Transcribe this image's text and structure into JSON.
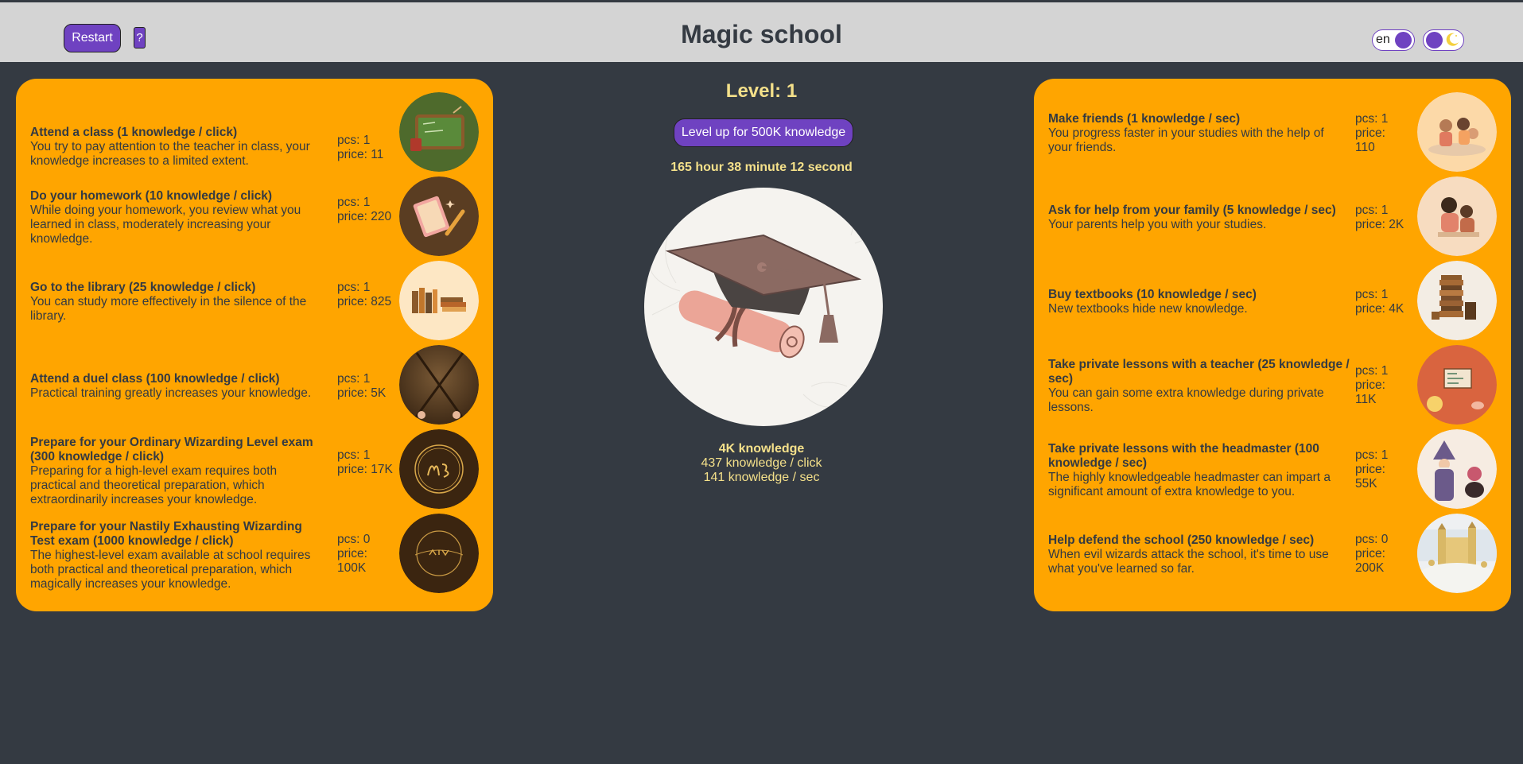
{
  "header": {
    "title": "Magic school",
    "restart_label": "Restart",
    "help_label": "?",
    "language": "en"
  },
  "colors": {
    "accent": "#6f42c1",
    "panel": "#ffa500",
    "background": "#343a42",
    "header_bg": "#d4d4d4",
    "highlight_text": "#f4e08a"
  },
  "center": {
    "level_label": "Level: 1",
    "level_up_label": "Level up for 500K knowledge",
    "timer": "165 hour 38 minute 12 second",
    "knowledge": "4K knowledge",
    "per_click": "437 knowledge / click",
    "per_sec": "141 knowledge / sec",
    "image_icon": "graduation-cap-diploma"
  },
  "click_upgrades": [
    {
      "name": "Attend a class (1 knowledge / click)",
      "desc": "You try to pay attention to the teacher in class, your knowledge increases to a limited extent.",
      "pcs": "pcs: 1",
      "price": "price: 11",
      "icon": "chalkboard-icon"
    },
    {
      "name": "Do your homework (10 knowledge / click)",
      "desc": "While doing your homework, you review what you learned in class, moderately increasing your knowledge.",
      "pcs": "pcs: 1",
      "price": "price: 220",
      "icon": "notebook-pencil-icon"
    },
    {
      "name": "Go to the library (25 knowledge / click)",
      "desc": "You can study more effectively in the silence of the library.",
      "pcs": "pcs: 1",
      "price": "price: 825",
      "icon": "books-icon"
    },
    {
      "name": "Attend a duel class (100 knowledge / click)",
      "desc": "Practical training greatly increases your knowledge.",
      "pcs": "pcs: 1",
      "price": "price: 5K",
      "icon": "wands-icon"
    },
    {
      "name": "Prepare for your Ordinary Wizarding Level exam (300 knowledge / click)",
      "desc": "Preparing for a high-level exam requires both practical and theoretical preparation, which extraordinarily increases your knowledge.",
      "pcs": "pcs: 1",
      "price": "price: 17K",
      "icon": "owl-seal-icon"
    },
    {
      "name": "Prepare for your Nastily Exhausting Wizarding Test exam (1000 knowledge / click)",
      "desc": "The highest-level exam available at school requires both practical and theoretical preparation, which magically increases your knowledge.",
      "pcs": "pcs: 0",
      "price": "price: 100K",
      "icon": "newt-seal-icon"
    }
  ],
  "passive_upgrades": [
    {
      "name": "Make friends (1 knowledge / sec)",
      "desc": "You progress faster in your studies with the help of your friends.",
      "pcs": "pcs: 1",
      "price": "price: 110",
      "icon": "friends-icon"
    },
    {
      "name": "Ask for help from your family (5 knowledge / sec)",
      "desc": "Your parents help you with your studies.",
      "pcs": "pcs: 1",
      "price": "price: 2K",
      "icon": "family-icon"
    },
    {
      "name": "Buy textbooks (10 knowledge / sec)",
      "desc": "New textbooks hide new knowledge.",
      "pcs": "pcs: 1",
      "price": "price: 4K",
      "icon": "textbooks-icon"
    },
    {
      "name": "Take private lessons with a teacher (25 knowledge / sec)",
      "desc": "You can gain some extra knowledge during private lessons.",
      "pcs": "pcs: 1",
      "price": "price: 11K",
      "icon": "teacher-icon"
    },
    {
      "name": "Take private lessons with the headmaster (100 knowledge / sec)",
      "desc": "The highly knowledgeable headmaster can impart a significant amount of extra knowledge to you.",
      "pcs": "pcs: 1",
      "price": "price: 55K",
      "icon": "headmaster-icon"
    },
    {
      "name": "Help defend the school (250 knowledge / sec)",
      "desc": "When evil wizards attack the school, it's time to use what you've learned so far.",
      "pcs": "pcs: 0",
      "price": "price: 200K",
      "icon": "castle-icon"
    }
  ]
}
